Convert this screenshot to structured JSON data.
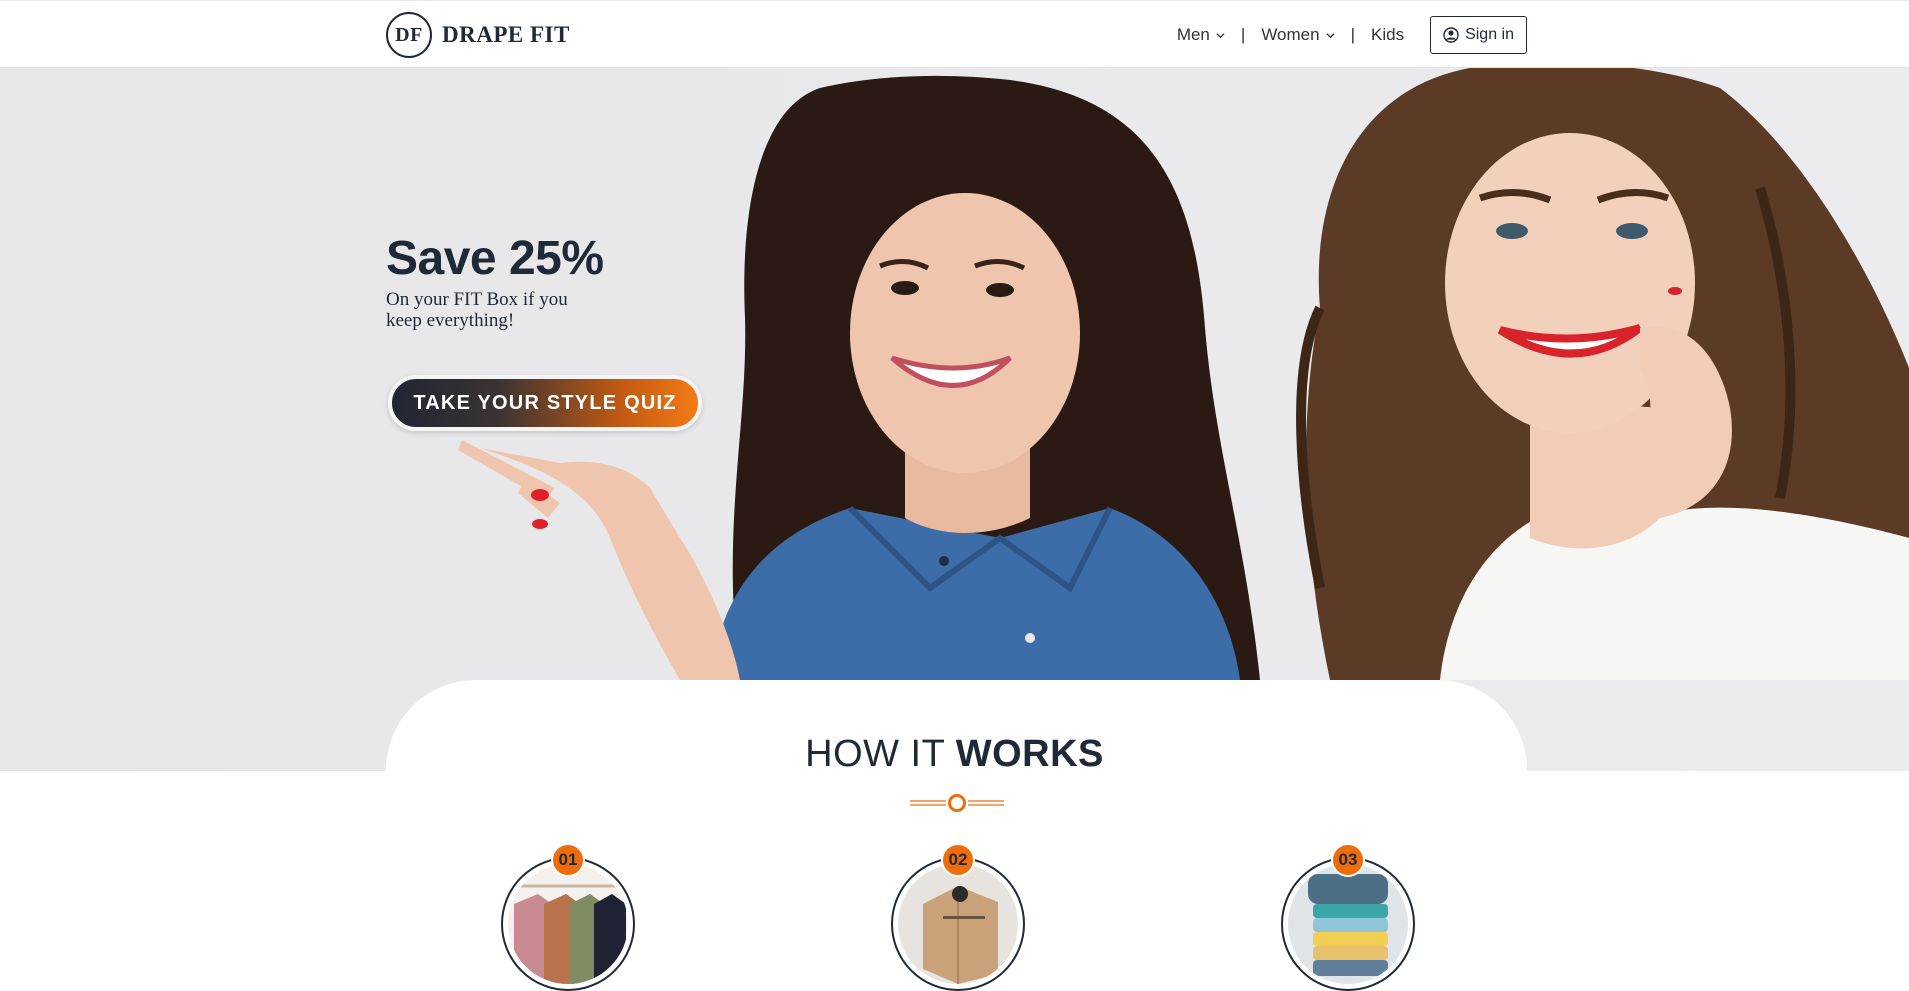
{
  "header": {
    "logo_mark": "DF",
    "logo_text": "DRAPE FIT",
    "nav": [
      {
        "label": "Men"
      },
      {
        "label": "Women"
      },
      {
        "label": "Kids"
      }
    ],
    "separator": "|",
    "signin_label": "Sign in"
  },
  "hero": {
    "title": "Save 25%",
    "subtitle": "On your FIT Box if you keep everything!",
    "cta_label": "TAKE YOUR STYLE QUIZ"
  },
  "how_it_works": {
    "title_light": "HOW IT ",
    "title_bold": "WORKS",
    "steps": [
      {
        "number": "01"
      },
      {
        "number": "02"
      },
      {
        "number": "03"
      }
    ]
  },
  "colors": {
    "accent": "#ef6c0b",
    "dark": "#1f2937",
    "hero_bg": "#e9e9eb"
  }
}
